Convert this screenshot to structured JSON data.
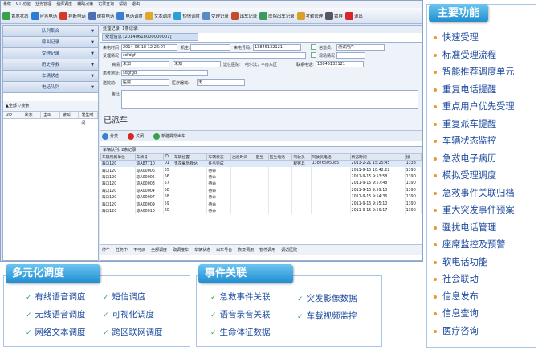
{
  "menubar": [
    "系统",
    "CTI功能",
    "业务管理",
    "指挥调度",
    "辅助决策",
    "记录查询",
    "帮助",
    "退出"
  ],
  "toolbar": [
    {
      "label": "置席状态",
      "color": "#3aa04a"
    },
    {
      "label": "应答电话",
      "color": "#2e7bd6"
    },
    {
      "label": "挂断电话",
      "color": "#d43a2a"
    },
    {
      "label": "缓拨电话",
      "color": "#4a6fb5"
    },
    {
      "label": "电话调度",
      "color": "#3a7fd1"
    },
    {
      "label": "文本调度",
      "color": "#e0a72e"
    },
    {
      "label": "短信调度",
      "color": "#2c9fd8"
    },
    {
      "label": "受理记录",
      "color": "#5b8ac9"
    },
    {
      "label": "出车记录",
      "color": "#c24e2c"
    },
    {
      "label": "医院出车记录",
      "color": "#3c9b5c"
    },
    {
      "label": "考勤管理",
      "color": "#d9a02a"
    },
    {
      "label": "锁屏",
      "color": "#556"
    },
    {
      "label": "退出",
      "color": "#d62828"
    }
  ],
  "sidebar": {
    "items": [
      "队列集合",
      "呼叫记录",
      "受理记录",
      "历史呼救",
      "车辆状态",
      "电话队列"
    ],
    "tools": "▲全部   ▽搜索",
    "columns": [
      "VIP",
      "状态",
      "主叫",
      "被叫",
      "发生时间"
    ]
  },
  "main": {
    "tabs": "处理记录: 1条记录:",
    "form_tab": "受理信息 [20140618000000001]",
    "form": {
      "call_time_label": "来电时间",
      "call_time": "2014-06-18 12:26:07",
      "ext_label": "机主:",
      "ext": "",
      "caller_no_label": "来电号码:",
      "caller_no": "13845132121",
      "source_label": "信道员:",
      "source": "测试用户",
      "record_label": "受理情况",
      "record": "sdfdgf",
      "remark_label": "现场情况",
      "remark": "",
      "level_label": "病情:",
      "level": "未知",
      "address_label": "地址:",
      "address": "",
      "position_label": "车号,",
      "position": "未知",
      "dest_label": "送往医院:",
      "dest": "哈尔滨，平房东区",
      "contact_label": "联系电话:",
      "contact": "13845132121",
      "patient_label": "患者地址:",
      "patient": "sdgfgd",
      "hospital_label": "送院前:",
      "hospital": "医院",
      "device_label": "医疗器械:",
      "device": "无",
      "notes_label": "备注:",
      "notes": ""
    },
    "dispatch_text": "已派车",
    "actions": [
      "分类",
      "关闭",
      "新建异常出车"
    ],
    "lower_tabs": "车辆队列: 2条记录:",
    "grid_headers": [
      "车辆所属单位",
      "车牌号",
      "ID",
      "车辆位置",
      "车辆状态",
      "出发时间",
      "医生",
      "医生电话",
      "驾驶员",
      "驾驶员电话",
      "状态时间",
      "接"
    ],
    "grid_rows": [
      [
        "海口120",
        "琼A87710",
        "01",
        "无花果急救站",
        "任务完成",
        "",
        "",
        "",
        "程宪兵",
        "13876505085",
        "2013-2-21 15:25:45",
        "1338"
      ],
      [
        "海口120",
        "琼A00006",
        "55",
        "",
        "待命",
        "",
        "",
        "",
        "",
        "",
        "2011-9-15 10:42:22",
        "1390"
      ],
      [
        "海口120",
        "琼A00005",
        "56",
        "",
        "待命",
        "",
        "",
        "",
        "",
        "",
        "2011-9-15 9:53:58",
        "1390"
      ],
      [
        "海口120",
        "琼A00003",
        "57",
        "",
        "待命",
        "",
        "",
        "",
        "",
        "",
        "2011-9-15 9:57:48",
        "1390"
      ],
      [
        "海口120",
        "琼A00004",
        "58",
        "",
        "待命",
        "",
        "",
        "",
        "",
        "",
        "2011-9-15 9:59:10",
        "1390"
      ],
      [
        "海口120",
        "琼A00007",
        "58",
        "",
        "待命",
        "",
        "",
        "",
        "",
        "",
        "2011-9-15 9:54:36",
        "1390"
      ],
      [
        "海口120",
        "琼A00009",
        "59",
        "",
        "待命",
        "",
        "",
        "",
        "",
        "",
        "2011-9-15 9:55:10",
        "1390"
      ],
      [
        "海口120",
        "琼A00010",
        "60",
        "",
        "待命",
        "",
        "",
        "",
        "",
        "",
        "2011-9-15 9:59:17",
        "1390"
      ]
    ],
    "status_buttons": [
      "停牛",
      "任务中",
      "不可派",
      "全部调度",
      "取调度车",
      "车辆状态",
      "出车号台",
      "恢复调用",
      "暂停调用",
      "调返医院"
    ]
  },
  "features": {
    "title": "主要功能",
    "items": [
      "快速受理",
      "标准受理流程",
      "智能推荐调度单元",
      "重复电话提醒",
      "重点用户优先受理",
      "重复派车提醒",
      "车辆状态监控",
      "急救电子病历",
      "模拟受理调度",
      "急救事件关联归档",
      "重大突发事件预案",
      "骚扰电话管理",
      "座席监控及预警",
      "软电话功能",
      "社会联动",
      "信息发布",
      "信息查询",
      "医疗咨询"
    ]
  },
  "dispatch_modes": {
    "title": "多元化调度",
    "items": [
      "有线语音调度",
      "短信调度",
      "无线语音调度",
      "可视化调度",
      "网络文本调度",
      "跨区联网调度"
    ]
  },
  "event_links": {
    "title": "事件关联",
    "items": [
      "急救事件关联",
      "突发影像数据",
      "语音录音关联",
      "车载视频监控",
      "生命体征数据"
    ]
  }
}
